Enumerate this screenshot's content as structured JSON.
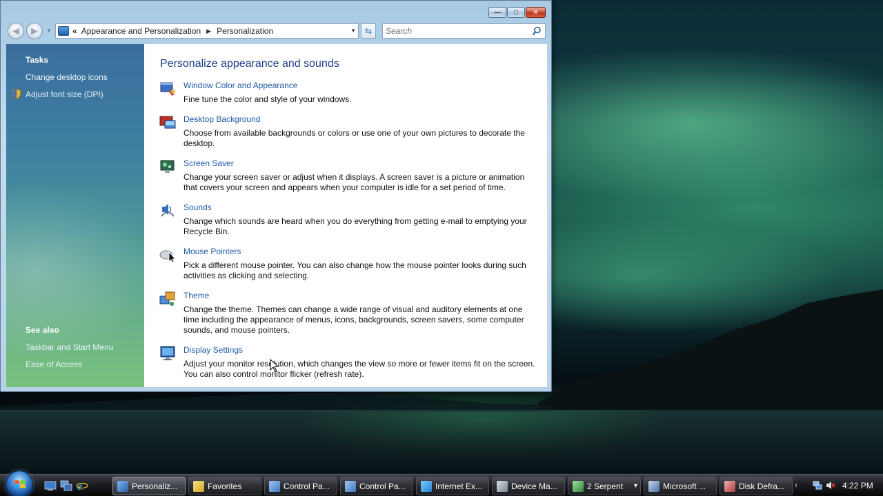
{
  "window": {
    "controls": {
      "minimize": "—",
      "maximize": "□",
      "close": "✕"
    },
    "address": {
      "chevron": "«",
      "crumbs": [
        "Appearance and Personalization",
        "Personalization"
      ],
      "separator": "▶"
    },
    "search": {
      "placeholder": "Search"
    }
  },
  "left_pane": {
    "tasks_heading": "Tasks",
    "tasks": [
      {
        "label": "Change desktop icons"
      },
      {
        "label": "Adjust font size (DPI)",
        "icon": "shield-icon"
      }
    ],
    "see_also_heading": "See also",
    "see_also": [
      {
        "label": "Taskbar and Start Menu"
      },
      {
        "label": "Ease of Access"
      }
    ]
  },
  "content": {
    "title": "Personalize appearance and sounds",
    "items": [
      {
        "title": "Window Color and Appearance",
        "icon": "window-color-icon",
        "desc": "Fine tune the color and style of your windows."
      },
      {
        "title": "Desktop Background",
        "icon": "desktop-background-icon",
        "desc": "Choose from available backgrounds or colors or use one of your own pictures to decorate the desktop."
      },
      {
        "title": "Screen Saver",
        "icon": "screen-saver-icon",
        "desc": "Change your screen saver or adjust when it displays. A screen saver is a picture or animation that covers your screen and appears when your computer is idle for a set period of time."
      },
      {
        "title": "Sounds",
        "icon": "sounds-icon",
        "desc": "Change which sounds are heard when you do everything from getting e-mail to emptying your Recycle Bin."
      },
      {
        "title": "Mouse Pointers",
        "icon": "mouse-pointers-icon",
        "desc": "Pick a different mouse pointer. You can also change how the mouse pointer looks during such activities as clicking and selecting."
      },
      {
        "title": "Theme",
        "icon": "theme-icon",
        "desc": "Change the theme. Themes can change a wide range of visual and auditory elements at one time including the appearance of menus, icons, backgrounds, screen savers, some computer sounds, and mouse pointers."
      },
      {
        "title": "Display Settings",
        "icon": "display-settings-icon",
        "desc": "Adjust your monitor resolution, which changes the view so more or fewer items fit on the screen. You can also control monitor flicker (refresh rate)."
      }
    ]
  },
  "taskbar": {
    "quick_launch": [
      "show-desktop-icon",
      "switch-windows-icon",
      "internet-explorer-icon"
    ],
    "tasks": [
      {
        "label": "Personaliz...",
        "icon": "personalization-icon",
        "active": true
      },
      {
        "label": "Favorites",
        "icon": "folder-icon"
      },
      {
        "label": "Control Pa...",
        "icon": "control-panel-icon"
      },
      {
        "label": "Control Pa...",
        "icon": "control-panel-icon"
      },
      {
        "label": "Internet Ex...",
        "icon": "internet-explorer-icon"
      },
      {
        "label": "Device Ma...",
        "icon": "device-manager-icon"
      },
      {
        "label": "2  Serpent",
        "icon": "serpent-icon",
        "dropdown": "▾"
      },
      {
        "label": "Microsoft ...",
        "icon": "microsoft-icon"
      },
      {
        "label": "Disk Defra...",
        "icon": "disk-defrag-icon"
      }
    ],
    "tray": {
      "chevron": "‹",
      "clock": "4:22 PM"
    }
  },
  "colors": {
    "link": "#1c5aa8",
    "title": "#1d3f8a",
    "pane_top": "#3a6e9c",
    "pane_bottom": "#79c27d"
  }
}
